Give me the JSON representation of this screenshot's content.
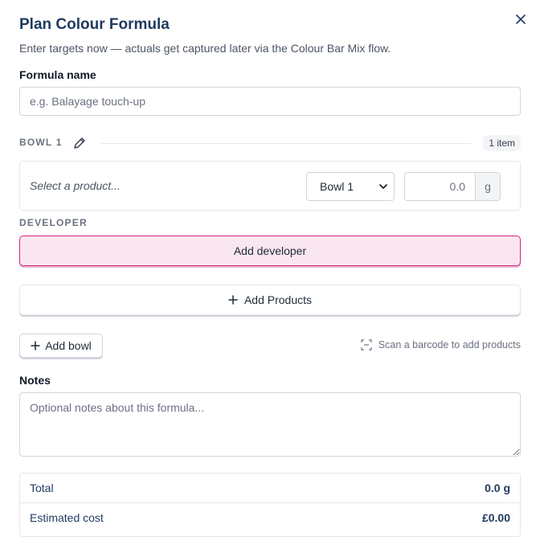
{
  "dialog": {
    "title": "Plan Colour Formula",
    "subtitle": "Enter targets now — actuals get captured later via the Colour Bar Mix flow."
  },
  "formula_name": {
    "label": "Formula name",
    "value": "",
    "placeholder": "e.g. Balayage touch-up"
  },
  "bowl": {
    "title": "BOWL 1",
    "item_count": "1 item",
    "product_placeholder": "Select a product...",
    "bowl_select_value": "Bowl 1",
    "quantity": "0.0",
    "unit": "g"
  },
  "developer": {
    "section_label": "DEVELOPER",
    "add_button": "Add developer"
  },
  "actions": {
    "add_products": "Add Products",
    "add_bowl": "Add bowl",
    "scan_hint": "Scan a barcode to add products"
  },
  "notes": {
    "label": "Notes",
    "placeholder": "Optional notes about this formula..."
  },
  "summary": {
    "total_label": "Total",
    "total_value": "0.0 g",
    "cost_label": "Estimated cost",
    "cost_value": "£0.00"
  },
  "colors": {
    "title": "#1f3a5f",
    "accent_border": "#d6247a",
    "accent_fill": "#fae6f0"
  },
  "icons": [
    "close-icon",
    "pencil-icon",
    "chevron-down-icon",
    "plus-icon",
    "barcode-scan-icon"
  ]
}
